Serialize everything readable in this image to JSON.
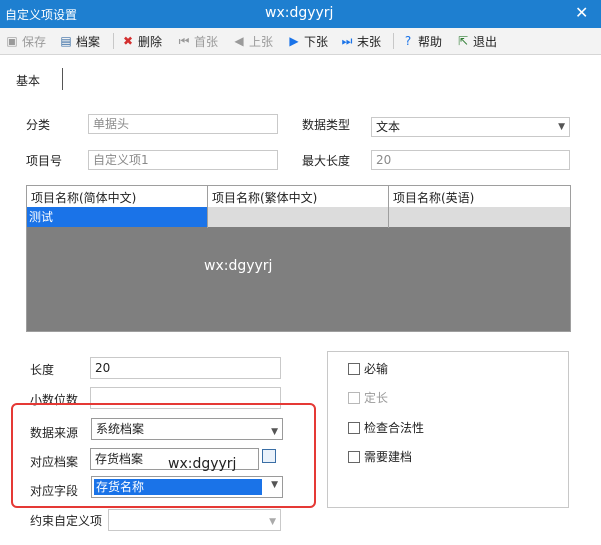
{
  "window": {
    "title": "自定义项设置",
    "watermark": "wx:dgyyrj",
    "close": "✕"
  },
  "toolbar": {
    "save": "保存",
    "archive": "档案",
    "delete": "删除",
    "first": "首张",
    "prev": "上张",
    "next": "下张",
    "last": "末张",
    "help": "帮助",
    "exit": "退出"
  },
  "tabs": {
    "basic": "基本"
  },
  "form": {
    "category_label": "分类",
    "category_value": "单据头",
    "datatype_label": "数据类型",
    "datatype_value": "文本",
    "itemno_label": "项目号",
    "itemno_value": "自定义项1",
    "maxlen_label": "最大长度",
    "maxlen_value": "20"
  },
  "grid": {
    "headers": [
      "项目名称(简体中文)",
      "项目名称(繁体中文)",
      "项目名称(英语)"
    ],
    "row1": [
      "测试",
      "",
      ""
    ],
    "watermark": "wx:dgyyrj"
  },
  "lower": {
    "length_label": "长度",
    "length_value": "20",
    "decimal_label": "小数位数",
    "decimal_value": "",
    "source_label": "数据来源",
    "source_value": "系统档案",
    "archive_label": "对应档案",
    "archive_value": "存货档案",
    "field_label": "对应字段",
    "field_value": "存货名称",
    "constraint_label": "约束自定义项",
    "constraint_value": "",
    "watermark": "wx:dgyyrj"
  },
  "checks": {
    "required": "必输",
    "fixed": "定长",
    "validate": "检查合法性",
    "need_archive": "需要建档"
  },
  "colors": {
    "title_bar": "#1e7fd0",
    "selection": "#1a73e8",
    "highlight_box": "#e53935"
  }
}
